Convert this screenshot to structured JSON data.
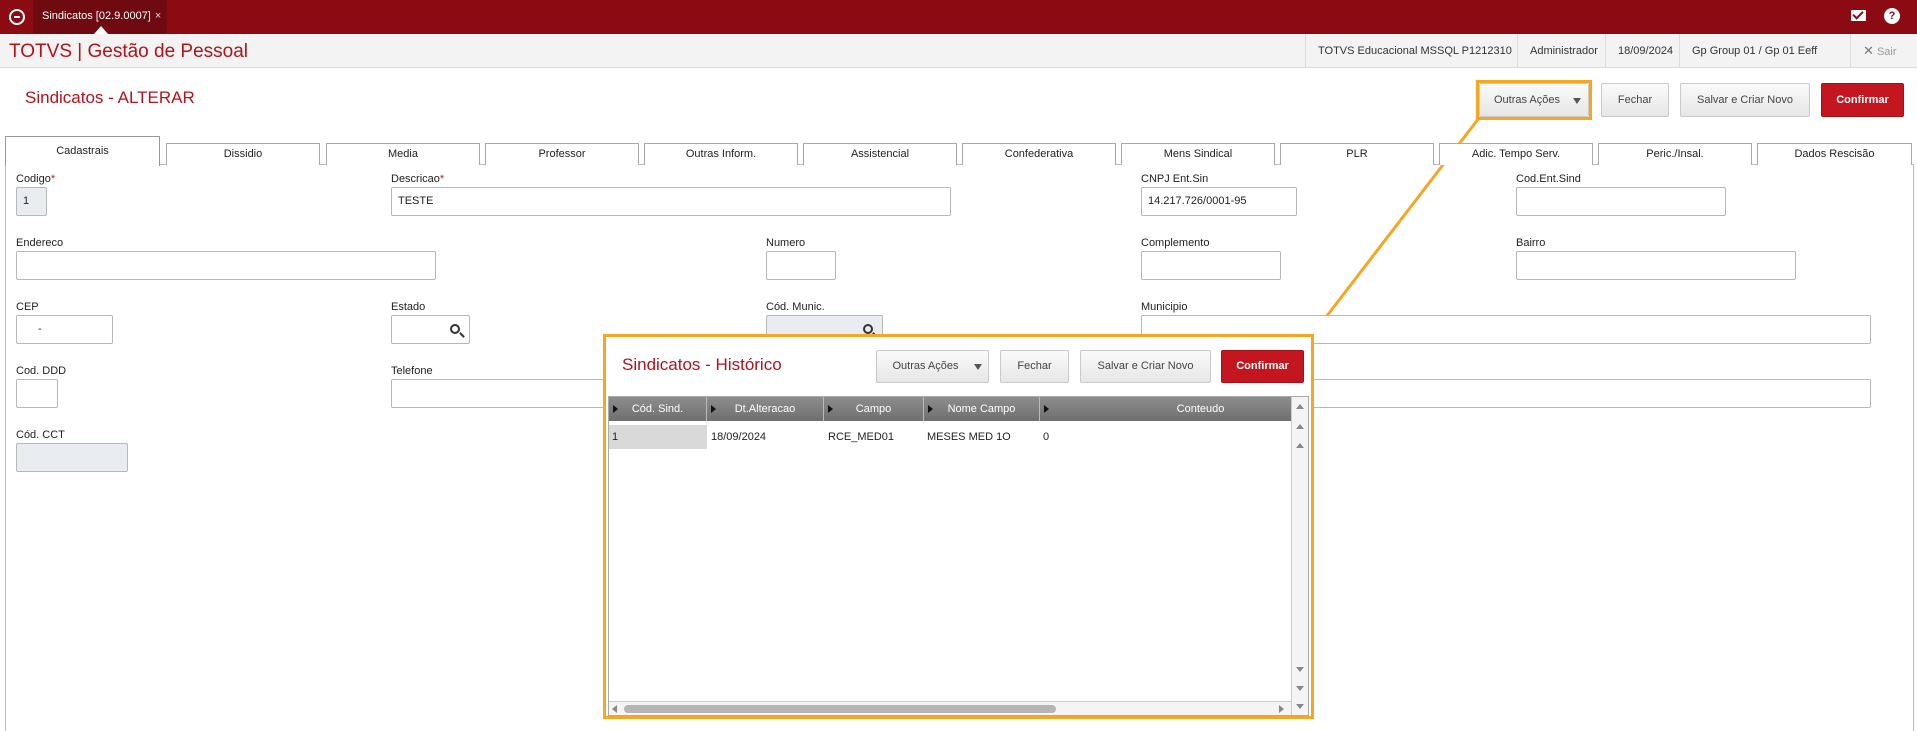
{
  "topbar": {
    "tab_label": "Sindicatos [02.9.0007]",
    "tab_close": "×"
  },
  "header": {
    "app_title": "TOTVS | Gestão de Pessoal",
    "environment": "TOTVS Educacional MSSQL P1212310",
    "user": "Administrador",
    "date": "18/09/2024",
    "group": "Gp Group 01 / Gp 01 Eeff",
    "logout": "Sair"
  },
  "form": {
    "title": "Sindicatos - ALTERAR",
    "actions": {
      "outras": "Outras Ações",
      "fechar": "Fechar",
      "salvar_novo": "Salvar e Criar Novo",
      "confirmar": "Confirmar"
    },
    "tabs": [
      "Cadastrais",
      "Dissidio",
      "Media",
      "Professor",
      "Outras Inform.",
      "Assistencial",
      "Confederativa",
      "Mens Sindical",
      "PLR",
      "Adic. Tempo Serv.",
      "Peric./Insal.",
      "Dados Rescisão"
    ],
    "fields": {
      "codigo": {
        "label": "Codigo",
        "value": "1"
      },
      "descricao": {
        "label": "Descricao",
        "value": "TESTE"
      },
      "cnpj": {
        "label": "CNPJ Ent.Sin",
        "value": "14.217.726/0001-95"
      },
      "cod_ent_sind": {
        "label": "Cod.Ent.Sind",
        "value": ""
      },
      "endereco": {
        "label": "Endereco",
        "value": ""
      },
      "numero": {
        "label": "Numero",
        "value": ""
      },
      "complemento": {
        "label": "Complemento",
        "value": ""
      },
      "bairro": {
        "label": "Bairro",
        "value": ""
      },
      "cep": {
        "label": "CEP",
        "value": "-"
      },
      "estado": {
        "label": "Estado",
        "value": ""
      },
      "cod_munic": {
        "label": "Cód. Munic.",
        "value": ""
      },
      "municipio": {
        "label": "Municipio",
        "value": ""
      },
      "cod_ddd": {
        "label": "Cod. DDD",
        "value": ""
      },
      "telefone": {
        "label": "Telefone",
        "value": ""
      },
      "cod_cct": {
        "label": "Cód. CCT",
        "value": ""
      }
    }
  },
  "popup": {
    "title": "Sindicatos - Histórico",
    "actions": {
      "outras": "Outras Ações",
      "fechar": "Fechar",
      "salvar_novo": "Salvar e Criar Novo",
      "confirmar": "Confirmar"
    },
    "columns": [
      "Cód. Sind.",
      "Dt.Alteracao",
      "Campo",
      "Nome Campo",
      "Conteudo"
    ],
    "rows": [
      [
        "1",
        "18/09/2024",
        "RCE_MED01",
        "MESES MED 1O",
        "0"
      ]
    ]
  },
  "colors": {
    "topbar": "#8c0a12",
    "accent": "#b5121b",
    "primary_button": "#c4161f",
    "highlight": "#f5a623"
  }
}
